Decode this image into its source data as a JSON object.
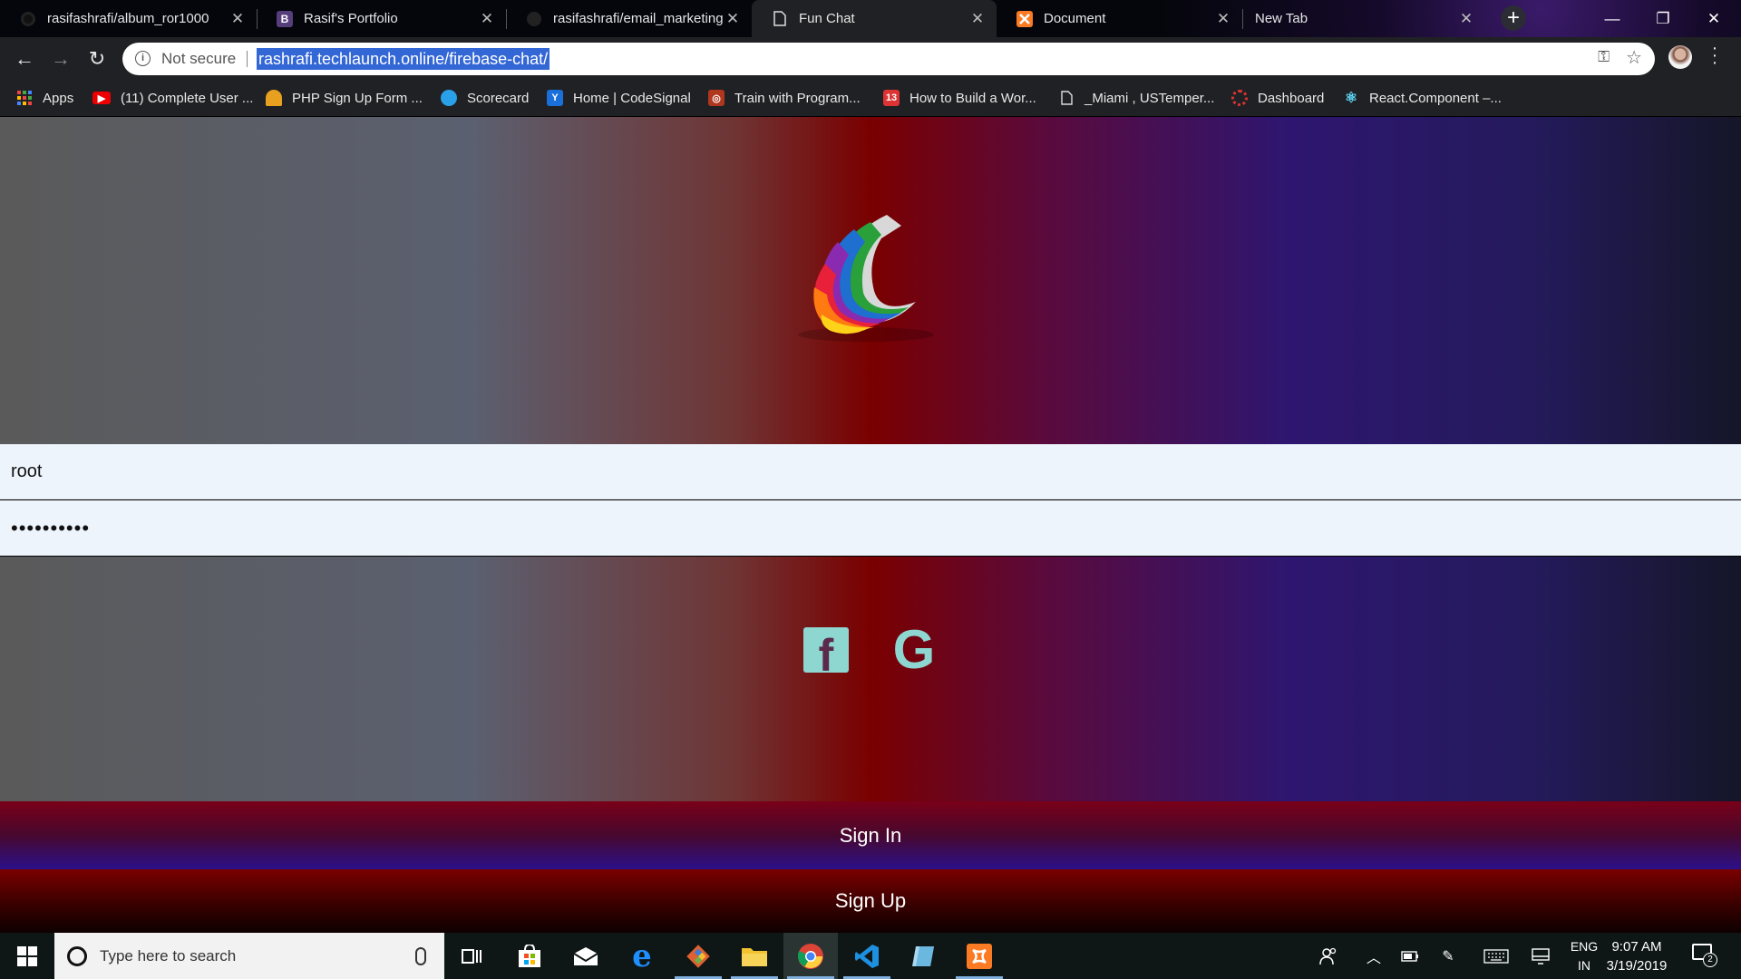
{
  "browser": {
    "tabs": [
      {
        "title": "rasifashrafi/album_ror1000",
        "icon": "github-icon"
      },
      {
        "title": "Rasif's Portfolio",
        "icon": "bootstrap-icon",
        "icon_text": "B"
      },
      {
        "title": "rasifashrafi/email_marketing",
        "icon": "github-icon"
      },
      {
        "title": "Fun Chat",
        "icon": "page-icon",
        "active": true
      },
      {
        "title": "Document",
        "icon": "xampp-icon"
      },
      {
        "title": "New Tab",
        "icon": "none"
      }
    ],
    "address": {
      "security": "Not secure",
      "url": "rashrafi.techlaunch.online/firebase-chat/"
    },
    "bookmarks": [
      {
        "label": "Apps",
        "icon": "apps-grid-icon"
      },
      {
        "label": "(11) Complete User ...",
        "icon": "youtube-icon"
      },
      {
        "label": "PHP Sign Up Form ...",
        "icon": "tutorial-icon"
      },
      {
        "label": "Scorecard",
        "icon": "globe-icon"
      },
      {
        "label": "Home | CodeSignal",
        "icon": "codesignal-icon"
      },
      {
        "label": "Train with Program...",
        "icon": "codewars-icon"
      },
      {
        "label": "How to Build a Wor...",
        "icon": "calendar-icon"
      },
      {
        "label": "_Miami , USTemper...",
        "icon": "page-icon"
      },
      {
        "label": "Dashboard",
        "icon": "dashboard-icon"
      },
      {
        "label": "React.Component –...",
        "icon": "react-icon"
      }
    ]
  },
  "app": {
    "username_value": "root",
    "password_value": "••••••••••",
    "signin_label": "Sign In",
    "signup_label": "Sign Up",
    "social_facebook_glyph": "f",
    "social_google_glyph": "G"
  },
  "taskbar": {
    "search_placeholder": "Type here to search",
    "lang_line1": "ENG",
    "lang_line2": "IN",
    "time": "9:07 AM",
    "date": "3/19/2019",
    "notification_count": "2"
  },
  "colors": {
    "teal_icon": "#8ed6d0",
    "field_bg": "#eef4fc",
    "url_highlight": "#3367d6"
  }
}
